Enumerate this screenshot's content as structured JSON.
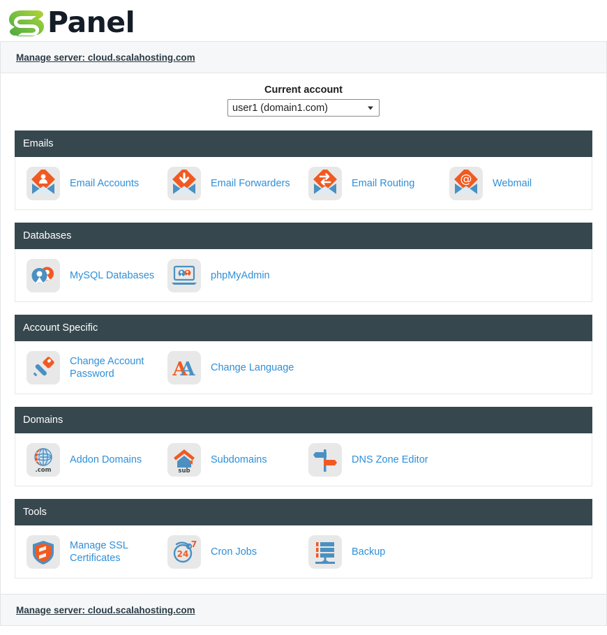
{
  "brand": {
    "logo_icon": "spanel-s-logo",
    "word": "Panel",
    "logo_green_light": "#8cc63f",
    "logo_green_dark": "#3ead4e",
    "word_color": "#131c27"
  },
  "header": {
    "server_link": "Manage server: cloud.scalahosting.com"
  },
  "account": {
    "label": "Current account",
    "selected": "user1 (domain1.com)",
    "options": [
      "user1 (domain1.com)"
    ]
  },
  "theme": {
    "section_header_bg": "#36474e",
    "link_color": "#2f8fd8",
    "icon_tile_bg": "#e8e8e8",
    "accent_orange": "#f05a22",
    "accent_blue": "#4a90c2"
  },
  "sections": [
    {
      "title": "Emails",
      "tiles": [
        {
          "label": "Email Accounts",
          "icon": "email-accounts-icon"
        },
        {
          "label": "Email Forwarders",
          "icon": "email-forwarders-icon"
        },
        {
          "label": "Email Routing",
          "icon": "email-routing-icon"
        },
        {
          "label": "Webmail",
          "icon": "webmail-icon"
        }
      ]
    },
    {
      "title": "Databases",
      "tiles": [
        {
          "label": "MySQL Databases",
          "icon": "mysql-databases-icon"
        },
        {
          "label": "phpMyAdmin",
          "icon": "phpmyadmin-icon"
        }
      ]
    },
    {
      "title": "Account Specific",
      "tiles": [
        {
          "label": "Change Account\nPassword",
          "icon": "key-icon"
        },
        {
          "label": "Change Language",
          "icon": "change-language-icon"
        }
      ]
    },
    {
      "title": "Domains",
      "tiles": [
        {
          "label": "Addon Domains",
          "icon": "addon-domains-icon"
        },
        {
          "label": "Subdomains",
          "icon": "subdomains-icon"
        },
        {
          "label": "DNS Zone Editor",
          "icon": "dns-zone-editor-icon"
        }
      ]
    },
    {
      "title": "Tools",
      "tiles": [
        {
          "label": "Manage SSL\nCertificates",
          "icon": "ssl-shield-icon"
        },
        {
          "label": "Cron Jobs",
          "icon": "cron-jobs-icon"
        },
        {
          "label": "Backup",
          "icon": "backup-icon"
        }
      ]
    }
  ],
  "footer": {
    "server_link": "Manage server: cloud.scalahosting.com"
  }
}
